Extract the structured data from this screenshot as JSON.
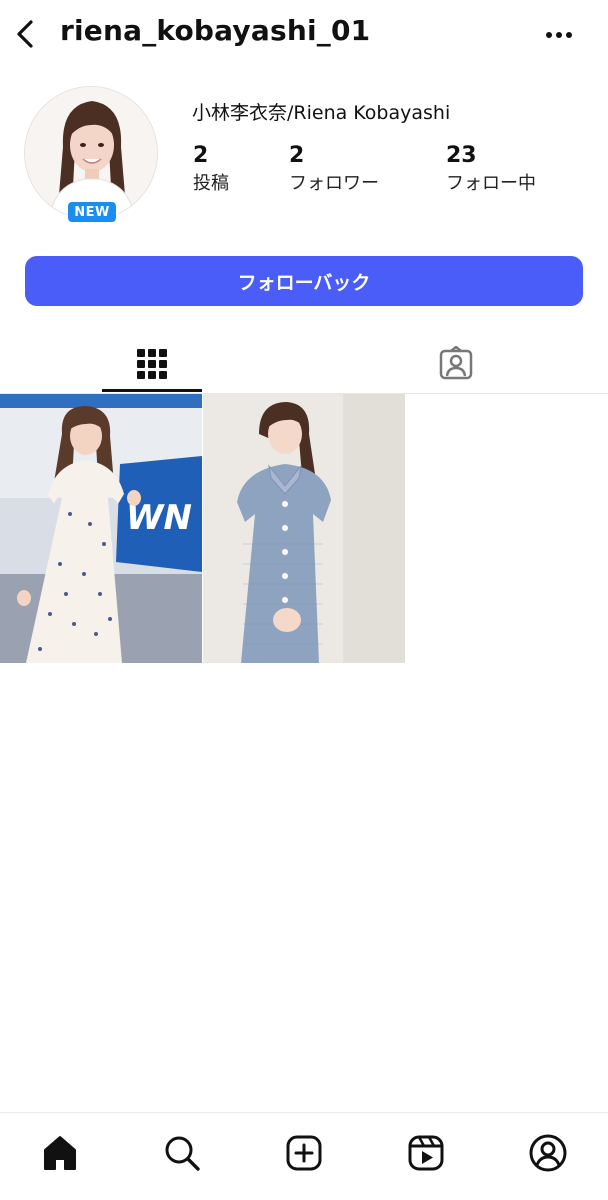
{
  "header": {
    "username": "riena_kobayashi_01",
    "back_icon": "chevron-left-icon",
    "more_icon": "more-horizontal-icon"
  },
  "profile": {
    "display_name": "小林李衣奈/Riena Kobayashi",
    "badge": "NEW",
    "stats": [
      {
        "value": "2",
        "label": "投稿"
      },
      {
        "value": "2",
        "label": "フォロワー"
      },
      {
        "value": "23",
        "label": "フォロー中"
      }
    ]
  },
  "actions": {
    "follow_back_label": "フォローバック",
    "follow_back_color": "#4a5df9"
  },
  "tabs": [
    {
      "icon": "grid-icon",
      "active": true
    },
    {
      "icon": "tagged-person-icon",
      "active": false
    }
  ],
  "posts": [
    {
      "description": "woman in white floral dress"
    },
    {
      "description": "woman in blue checked dress"
    }
  ],
  "bottom_nav": [
    {
      "icon": "home-icon",
      "active": true
    },
    {
      "icon": "search-icon"
    },
    {
      "icon": "create-post-icon"
    },
    {
      "icon": "reels-icon"
    },
    {
      "icon": "profile-icon"
    }
  ],
  "colors": {
    "accent": "#4a5df9",
    "badge": "#1a8ef0",
    "text": "#111111"
  }
}
